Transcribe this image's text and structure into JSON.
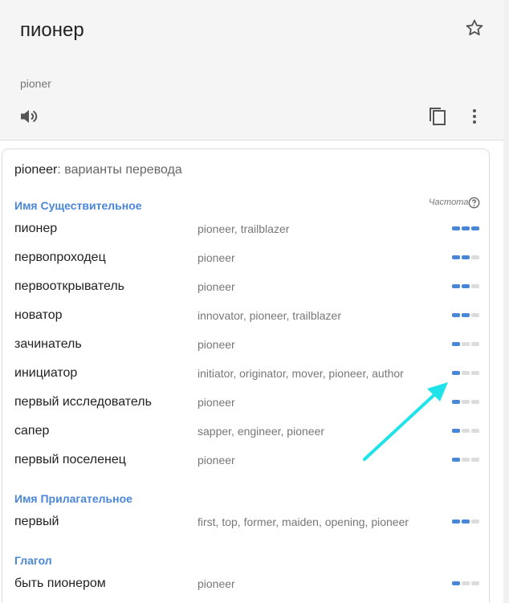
{
  "header": {
    "word": "пионер",
    "transliteration": "pioner"
  },
  "icons": [
    "star-icon",
    "speaker-icon",
    "copy-icon",
    "more-vert-icon",
    "help-icon"
  ],
  "card": {
    "headword": "pioneer",
    "subtitle": ": варианты перевода",
    "frequency_label": "Частота"
  },
  "colors": {
    "accent": "#4a86d8",
    "bar_empty": "#dcdcdc",
    "annotation_arrow": "#1fe3e8"
  },
  "sections": [
    {
      "pos": "Имя Существительное",
      "entries": [
        {
          "word": "пионер",
          "translations": "pioneer, trailblazer",
          "frequency": 3
        },
        {
          "word": "первопроходец",
          "translations": "pioneer",
          "frequency": 2
        },
        {
          "word": "первооткрыватель",
          "translations": "pioneer",
          "frequency": 2
        },
        {
          "word": "новатор",
          "translations": "innovator, pioneer, trailblazer",
          "frequency": 2
        },
        {
          "word": "зачинатель",
          "translations": "pioneer",
          "frequency": 1
        },
        {
          "word": "инициатор",
          "translations": "initiator, originator, mover, pioneer, author",
          "frequency": 1
        },
        {
          "word": "первый исследователь",
          "translations": "pioneer",
          "frequency": 1
        },
        {
          "word": "сапер",
          "translations": "sapper, engineer, pioneer",
          "frequency": 1
        },
        {
          "word": "первый поселенец",
          "translations": "pioneer",
          "frequency": 1
        }
      ]
    },
    {
      "pos": "Имя Прилагательное",
      "entries": [
        {
          "word": "первый",
          "translations": "first, top, former, maiden, opening, pioneer",
          "frequency": 2
        }
      ]
    },
    {
      "pos": "Глагол",
      "entries": [
        {
          "word": "быть пионером",
          "translations": "pioneer",
          "frequency": 1
        }
      ]
    }
  ]
}
